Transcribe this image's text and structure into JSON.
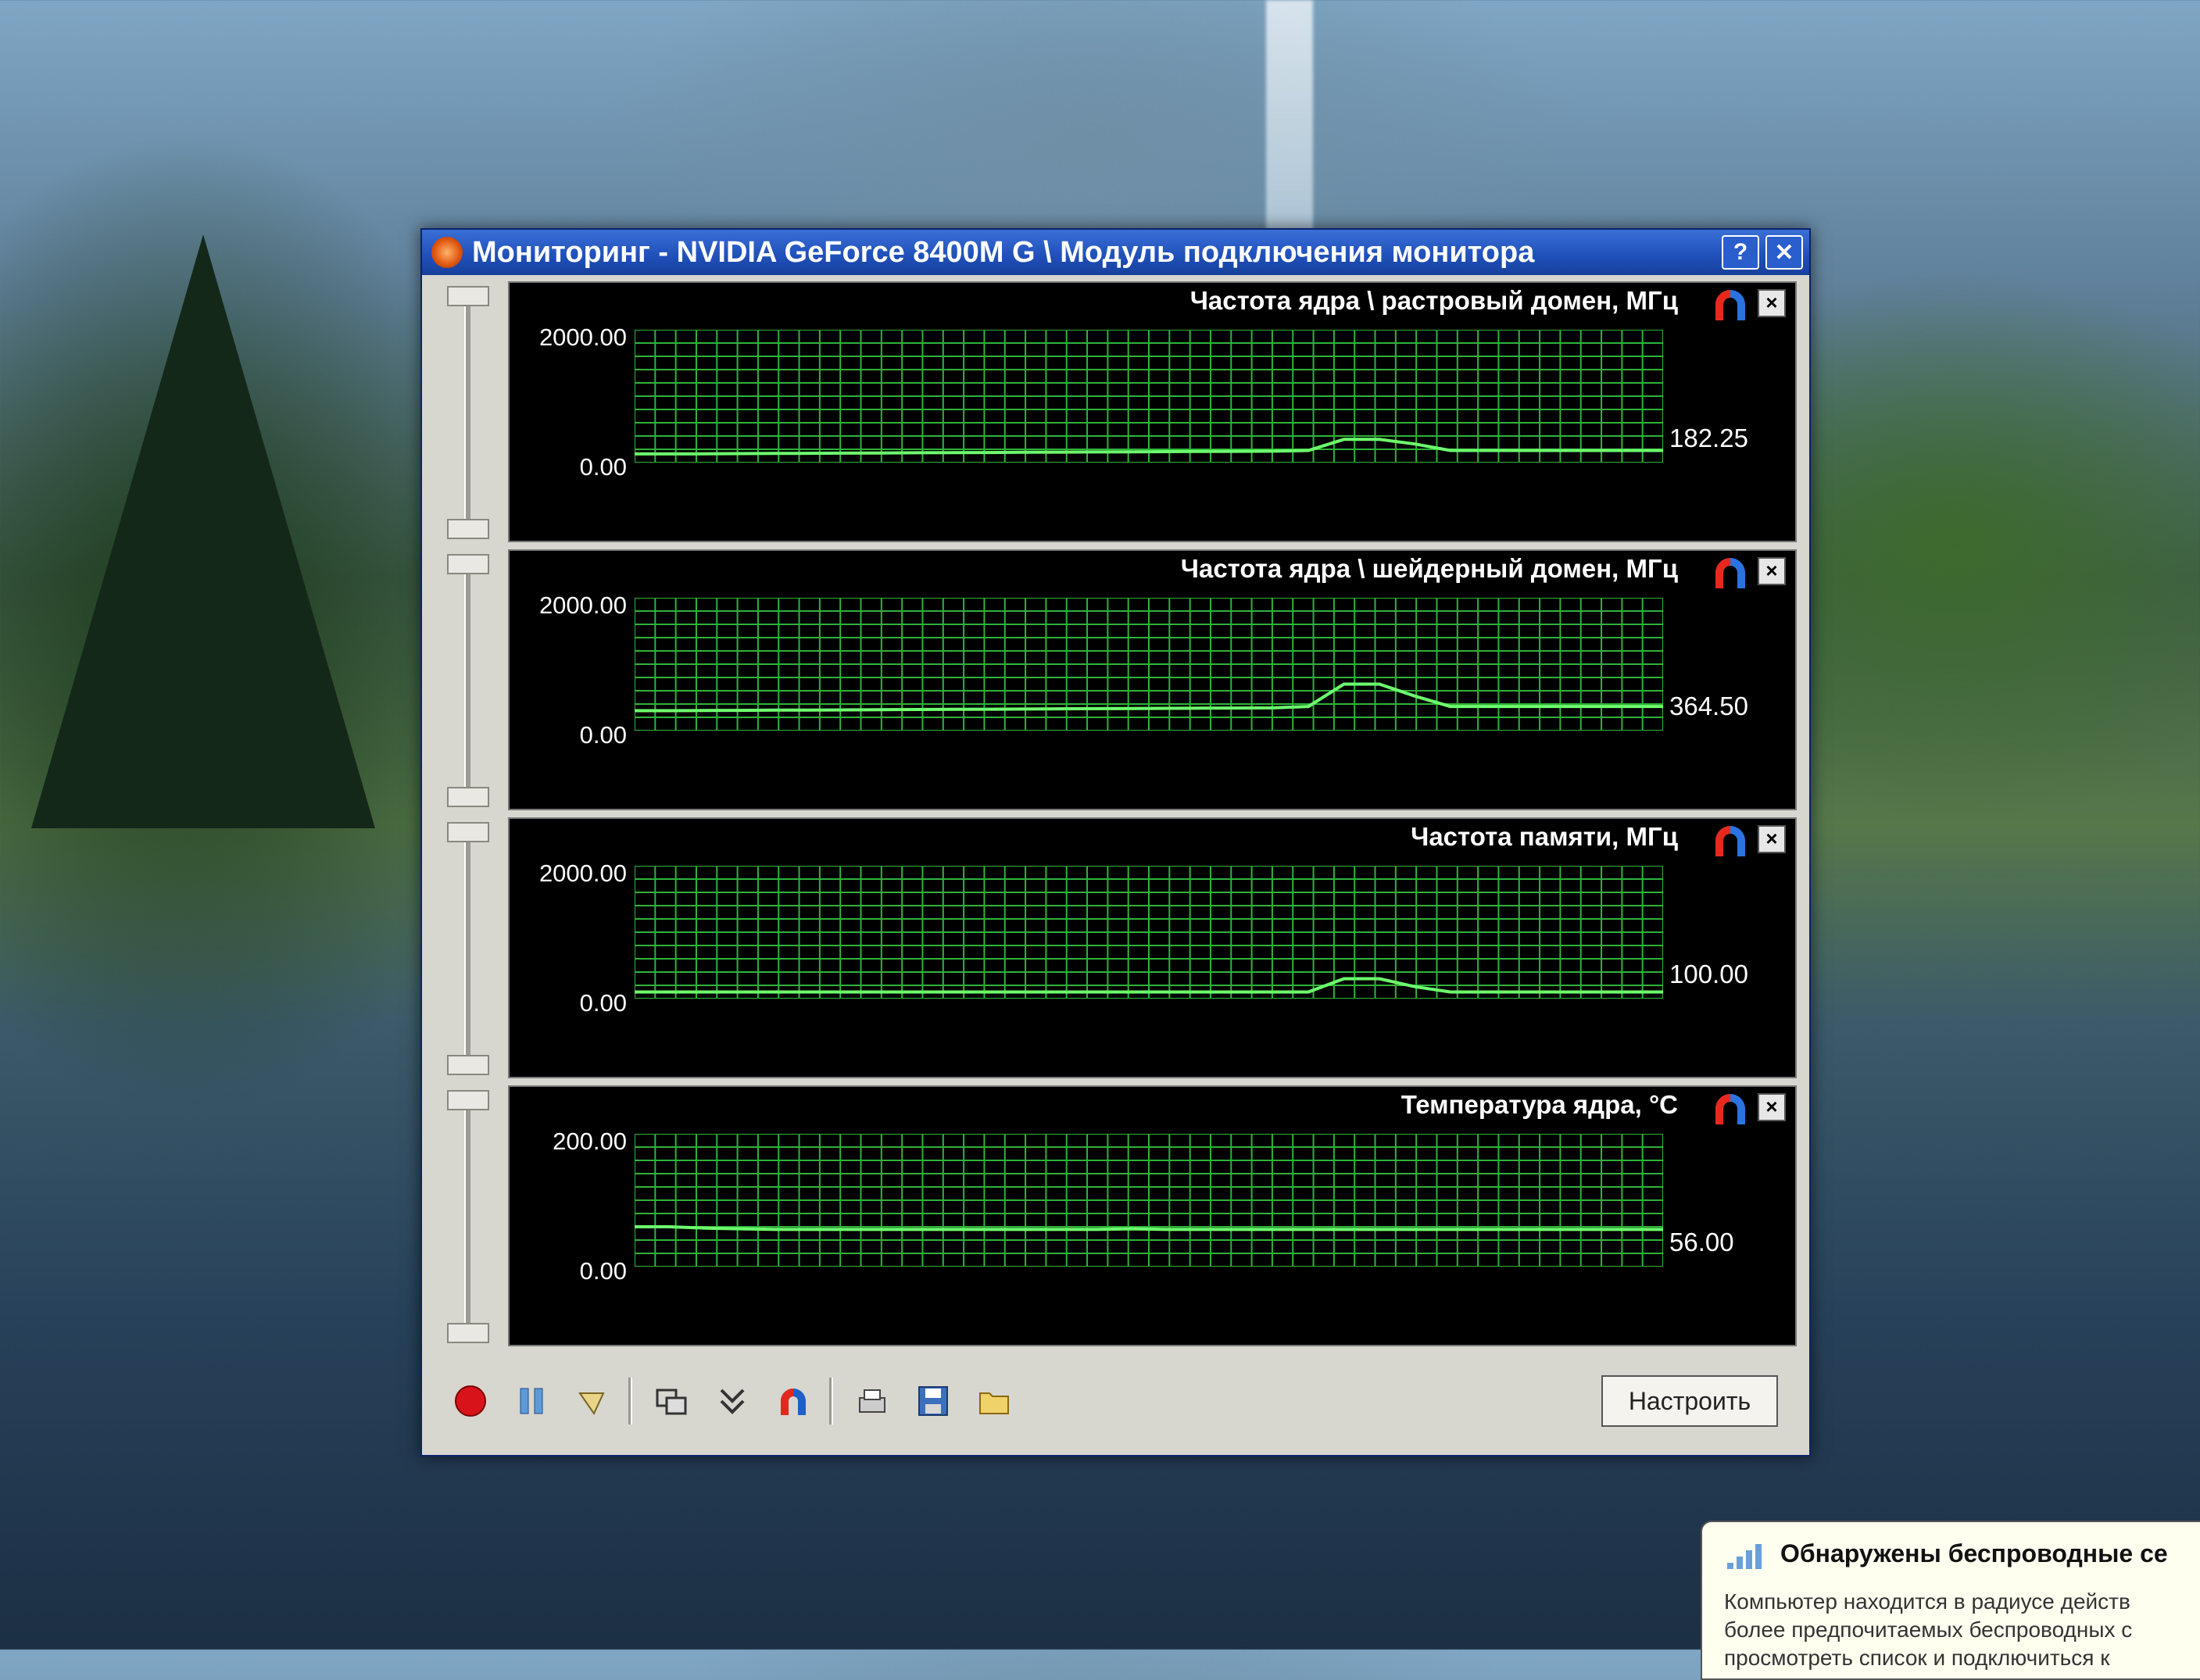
{
  "window": {
    "title": "Мониторинг - NVIDIA GeForce 8400M G    \\ Модуль подключения монитора",
    "help_label": "?",
    "close_label": "✕"
  },
  "graphs": [
    {
      "title": "Частота ядра \\ растровый домен, МГц",
      "ymax": "2000.00",
      "ymin": "0.00",
      "current": "182.25",
      "chart_data": {
        "type": "line",
        "ylim": [
          0,
          2000
        ],
        "values": [
          130,
          130,
          132,
          135,
          138,
          140,
          142,
          145,
          148,
          150,
          152,
          155,
          158,
          160,
          162,
          165,
          168,
          170,
          172,
          182,
          350,
          350,
          280,
          182,
          182,
          182,
          182,
          182,
          182,
          182
        ]
      }
    },
    {
      "title": "Частота ядра \\ шейдерный домен, МГц",
      "ymax": "2000.00",
      "ymin": "0.00",
      "current": "364.50",
      "chart_data": {
        "type": "line",
        "ylim": [
          0,
          2000
        ],
        "values": [
          300,
          300,
          302,
          305,
          308,
          310,
          312,
          315,
          318,
          320,
          322,
          325,
          328,
          330,
          332,
          335,
          338,
          340,
          342,
          364,
          700,
          700,
          520,
          364,
          364,
          364,
          364,
          364,
          364,
          364
        ]
      }
    },
    {
      "title": "Частота памяти, МГц",
      "ymax": "2000.00",
      "ymin": "0.00",
      "current": "100.00",
      "chart_data": {
        "type": "line",
        "ylim": [
          0,
          2000
        ],
        "values": [
          100,
          100,
          100,
          100,
          100,
          100,
          100,
          100,
          100,
          100,
          100,
          100,
          100,
          100,
          100,
          100,
          100,
          100,
          100,
          100,
          300,
          300,
          180,
          100,
          100,
          100,
          100,
          100,
          100,
          100
        ]
      }
    },
    {
      "title": "Температура ядра, °C",
      "ymax": "200.00",
      "ymin": "0.00",
      "current": "56.00",
      "chart_data": {
        "type": "line",
        "ylim": [
          0,
          200
        ],
        "values": [
          60,
          60,
          58,
          57,
          56,
          56,
          56,
          56,
          56,
          56,
          56,
          56,
          56,
          56,
          57,
          56,
          56,
          56,
          56,
          56,
          56,
          56,
          56,
          56,
          56,
          56,
          56,
          56,
          56,
          56
        ]
      }
    }
  ],
  "toolbar": {
    "record_icon": "record-icon",
    "pause_icon": "pause-icon",
    "setup_label": "Настроить"
  },
  "balloon": {
    "title": "Обнаружены беспроводные се",
    "line1": "Компьютер находится в радиусе действ",
    "line2": "более предпочитаемых беспроводных с",
    "line3": "просмотреть список и подключиться к"
  },
  "colors": {
    "grid": "#2fb33a",
    "trace": "#6dff6d",
    "titlebar": "#1f4fb8"
  }
}
